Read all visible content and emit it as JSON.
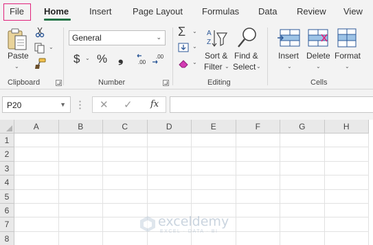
{
  "tabs": [
    {
      "label": "File"
    },
    {
      "label": "Home"
    },
    {
      "label": "Insert"
    },
    {
      "label": "Page Layout"
    },
    {
      "label": "Formulas"
    },
    {
      "label": "Data"
    },
    {
      "label": "Review"
    },
    {
      "label": "View"
    }
  ],
  "active_tab": "Home",
  "highlight_color": "#e0217a",
  "accent_color": "#217346",
  "ribbon": {
    "clipboard": {
      "paste_label": "Paste",
      "group_label": "Clipboard"
    },
    "number": {
      "format_value": "General",
      "currency_symbol": "$",
      "percent_symbol": "%",
      "comma_symbol": "❟",
      "increase_decimal": ".00",
      "decrease_decimal": ".00",
      "group_label": "Number"
    },
    "editing": {
      "sort_filter_line1": "Sort &",
      "sort_filter_line2": "Filter",
      "find_select_line1": "Find &",
      "find_select_line2": "Select",
      "group_label": "Editing"
    },
    "cells": {
      "insert_label": "Insert",
      "delete_label": "Delete",
      "format_label": "Format",
      "group_label": "Cells"
    }
  },
  "formula_bar": {
    "name_box": "P20",
    "fx_label": "fx",
    "formula": ""
  },
  "grid": {
    "columns": [
      "A",
      "B",
      "C",
      "D",
      "E",
      "F",
      "G",
      "H"
    ],
    "rows": [
      "1",
      "2",
      "3",
      "4",
      "5",
      "6",
      "7",
      "8"
    ]
  },
  "watermark": {
    "name": "exceldemy",
    "tagline": "EXCEL · DATA · BI"
  }
}
